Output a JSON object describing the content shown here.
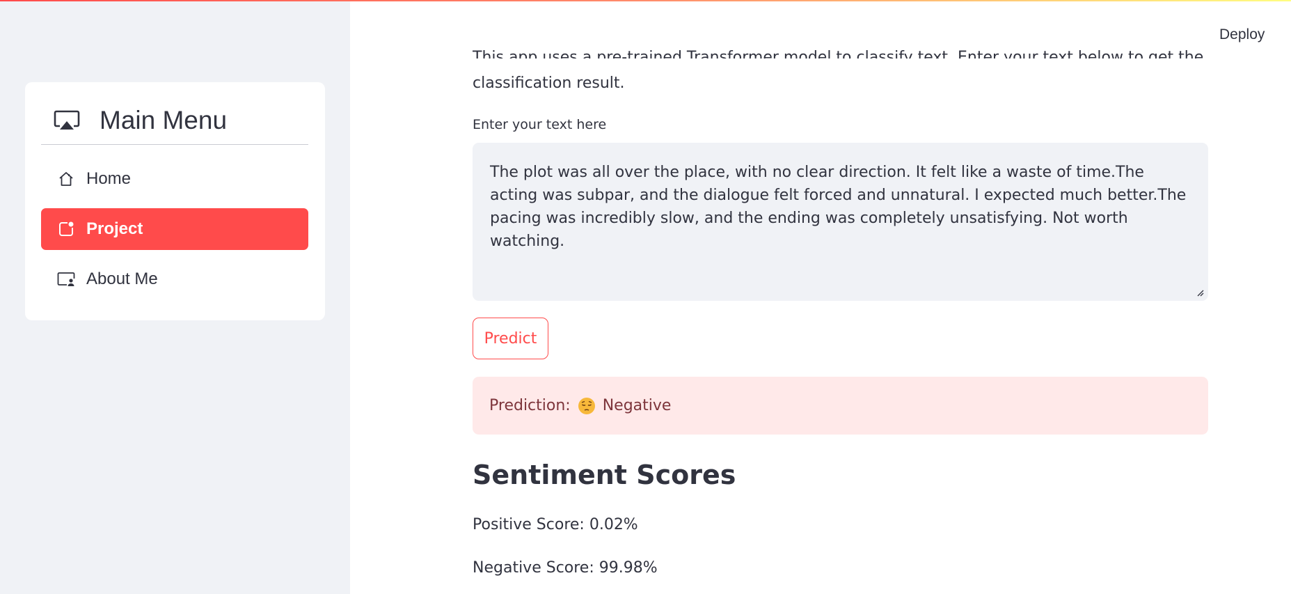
{
  "sidebar": {
    "menu_title": "Main Menu",
    "items": [
      {
        "label": "Home",
        "icon": "house-icon",
        "active": false
      },
      {
        "label": "Project",
        "icon": "app-indicator-icon",
        "active": true
      },
      {
        "label": "About Me",
        "icon": "person-video-icon",
        "active": false
      }
    ]
  },
  "header": {
    "deploy_label": "Deploy"
  },
  "main": {
    "intro_line1": "This app uses a pre-trained Transformer model to classify text. Enter your text below to get the",
    "intro_line2": "classification result.",
    "text_label": "Enter your text here",
    "text_value": "The plot was all over the place, with no clear direction. It felt like a waste of time.The acting was subpar, and the dialogue felt forced and unnatural. I expected much better.The pacing was incredibly slow, and the ending was completely unsatisfying. Not worth watching.",
    "predict_label": "Predict",
    "prediction_prefix": "Prediction:",
    "prediction_value": "Negative",
    "prediction_emoji": "pensive-face-emoji",
    "scores_title": "Sentiment Scores",
    "positive_score": "Positive Score: 0.02%",
    "negative_score": "Negative Score: 99.98%"
  },
  "colors": {
    "accent": "#ff4b4b",
    "sidebar_bg": "#f0f2f6",
    "alert_bg": "#ffe9e9",
    "alert_text": "#7d353b",
    "text": "#31333f"
  }
}
